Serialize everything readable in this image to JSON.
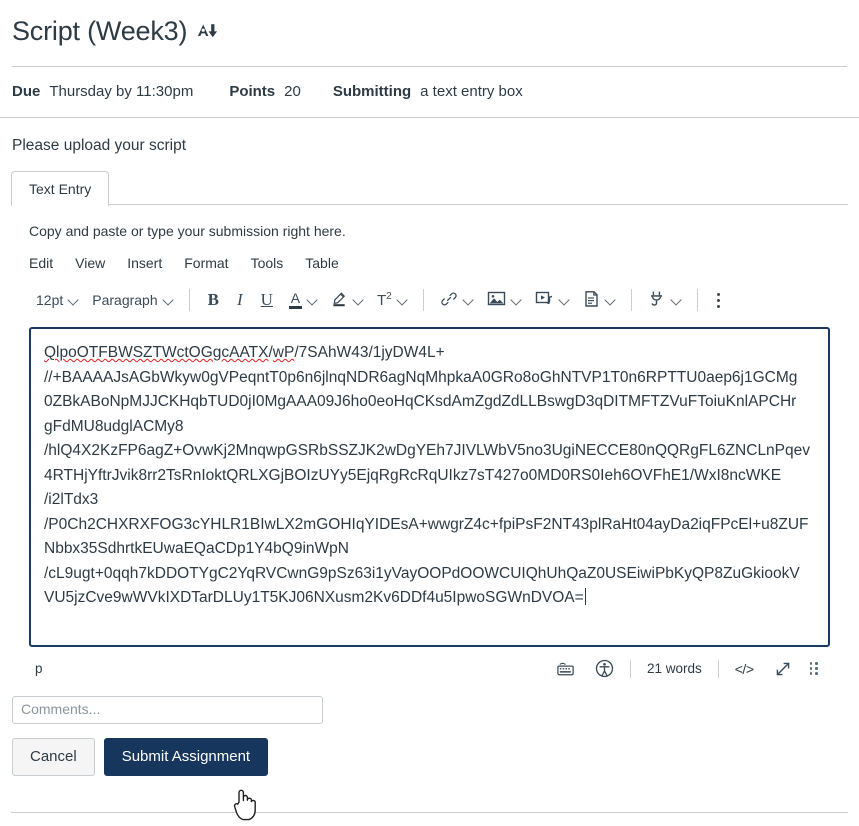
{
  "header": {
    "title": "Script (Week3)",
    "reader_icon": "immersive-reader-icon",
    "due_label": "Due",
    "due_value": "Thursday by 11:30pm",
    "points_label": "Points",
    "points_value": "20",
    "submitting_label": "Submitting",
    "submitting_value": "a text entry box"
  },
  "instructions": "Please upload your script",
  "tabs": [
    {
      "label": "Text Entry",
      "selected": true
    }
  ],
  "editor": {
    "paste_hint": "Copy and paste or type your submission right here.",
    "menubar": [
      "Edit",
      "View",
      "Insert",
      "Format",
      "Tools",
      "Table"
    ],
    "toolbar": {
      "font_size": "12pt",
      "block_format": "Paragraph",
      "bold": "B",
      "italic": "I",
      "underline": "U",
      "text_color": "A",
      "highlight": "highlighter-icon",
      "superscript": "T",
      "superscript_exp": "2",
      "link": "link-icon",
      "image": "image-icon",
      "media": "media-icon",
      "document": "document-icon",
      "apps": "plug-icon",
      "more": "kebab-menu-icon"
    },
    "content_lines": [
      "QlpoOTFBWSZTWctOGgcAATX/wP/7SAhW43/1jyDW4L+",
      "//+BAAAAJsAGbWkyw0gVPeqntT0p6n6jlnqNDR6agNqMhpkaA0GRo8oGhNTVP1T0n6RPTTU0aep6j1GCMg",
      "0ZBkABoNpMJJCKHqbTUD0jI0MgAAA09J6ho0eoHqCKsdAmZgdZdLLBswgD3qDITMFTZVuFToiuKnlAPCHr",
      "gFdMU8udglACMy8",
      "/hlQ4X2KzFP6agZ+OvwKj2MnqwpGSRbSSZJK2wDgYEh7JIVLWbV5no3UgiNECCE80nQQRgFL6ZNCLnPqev",
      "4RTHjYftrJvik8rr2TsRnIoktQRLXGjBOIzUYy5EjqRgRcRqUIkz7sT427o0MD0RS0Ieh6OVFhE1/WxI8ncWKE",
      "/i2lTdx3",
      "/P0Ch2CHXRXFOG3cYHLR1BIwLX2mGOHIqYIDEsA+wwgrZ4c+fpiPsF2NT43plRaHt04ayDa2iqFPcEl+u8ZUF",
      "Nbbx35SdhrtkEUwaEQaCDp1Y4bQ9inWpN",
      "/cL9ugt+0qqh7kDDOTYgC2YqRVCwnG9pSz63i1yVayOOPdOOWCUIQhUhQaZ0USEiwiPbKyQP8ZuGkiookV",
      "VU5jzCve9wWVkIXDTarDLUy1T5KJ06NXusm2Kv6DDf4u5IpwoSGWnDVOA="
    ],
    "misspelled_prefix": "QlpoOTFBWSZTWctOGgcAATX",
    "misspelled_second": "wP"
  },
  "statusbar": {
    "path": "p",
    "keyboard_icon": "keyboard-icon",
    "accessibility_icon": "accessibility-icon",
    "word_count": "21 words",
    "html_editor": "</>",
    "fullscreen_icon": "expand-arrow-icon",
    "resize_handle": "resize-grip-icon"
  },
  "footer": {
    "comments_placeholder": "Comments...",
    "cancel_label": "Cancel",
    "submit_label": "Submit Assignment"
  },
  "colors": {
    "brand": "#17365D",
    "text": "#2D3B45",
    "border": "#C7CDD1",
    "focus_border": "#1B3A63",
    "spellcheck": "#e02020"
  }
}
